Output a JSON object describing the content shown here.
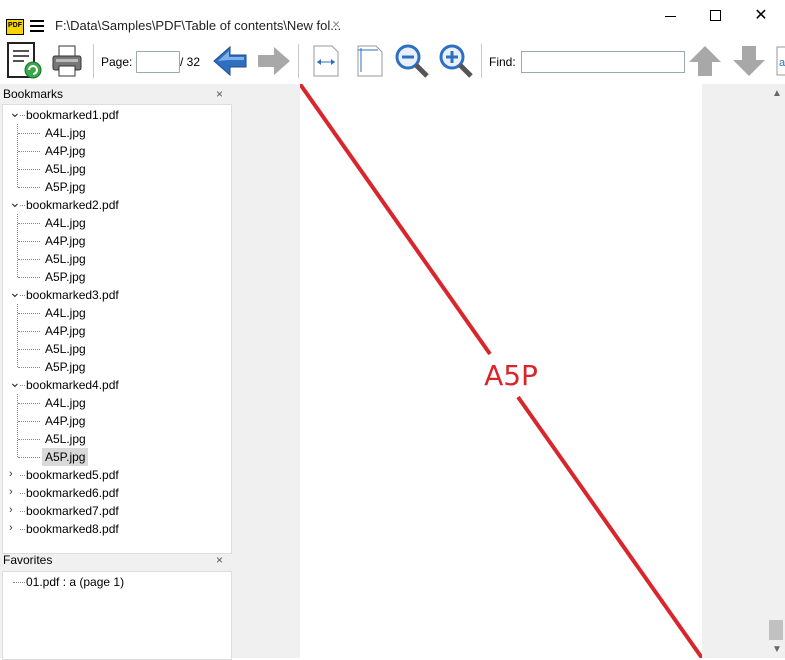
{
  "window": {
    "title": "F:\\Data\\Samples\\PDF\\Table of contents\\New fol...",
    "tab_close": "×",
    "close_glyph": "✕"
  },
  "app_icon_text": "PDF",
  "toolbar": {
    "page_label": "Page:",
    "page_value": "",
    "page_total": "/ 32",
    "find_label": "Find:",
    "find_value": ""
  },
  "bookmarks": {
    "title": "Bookmarks",
    "close": "×",
    "groups": [
      {
        "label": "bookmarked1.pdf",
        "expanded": true,
        "children": [
          "A4L.jpg",
          "A4P.jpg",
          "A5L.jpg",
          "A5P.jpg"
        ]
      },
      {
        "label": "bookmarked2.pdf",
        "expanded": true,
        "children": [
          "A4L.jpg",
          "A4P.jpg",
          "A5L.jpg",
          "A5P.jpg"
        ]
      },
      {
        "label": "bookmarked3.pdf",
        "expanded": true,
        "children": [
          "A4L.jpg",
          "A4P.jpg",
          "A5L.jpg",
          "A5P.jpg"
        ]
      },
      {
        "label": "bookmarked4.pdf",
        "expanded": true,
        "children": [
          "A4L.jpg",
          "A4P.jpg",
          "A5L.jpg",
          "A5P.jpg"
        ]
      },
      {
        "label": "bookmarked5.pdf",
        "expanded": false,
        "children": []
      },
      {
        "label": "bookmarked6.pdf",
        "expanded": false,
        "children": []
      },
      {
        "label": "bookmarked7.pdf",
        "expanded": false,
        "children": []
      },
      {
        "label": "bookmarked8.pdf",
        "expanded": false,
        "children": []
      }
    ],
    "selected": "bookmarked4.pdf/A5P.jpg"
  },
  "favorites": {
    "title": "Favorites",
    "close": "×",
    "items": [
      "01.pdf : a (page 1)"
    ]
  },
  "page_content": {
    "label": "A5P",
    "line_color": "#d9262c"
  },
  "colors": {
    "arrow_blue": "#2f6fc0",
    "arrow_gray": "#a8a8a8"
  }
}
